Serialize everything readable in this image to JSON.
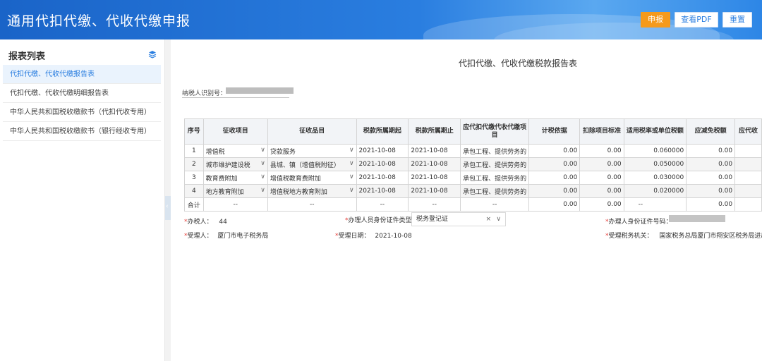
{
  "header": {
    "title": "通用代扣代缴、代收代缴申报",
    "buttons": {
      "submit": "申报",
      "pdf": "查看PDF",
      "reset": "重置"
    }
  },
  "sidebar": {
    "title": "报表列表",
    "items": [
      {
        "label": "代扣代缴、代收代缴报告表",
        "active": true
      },
      {
        "label": "代扣代缴、代收代缴明细报告表"
      },
      {
        "label": "中华人民共和国税收缴款书（代扣代收专用）"
      },
      {
        "label": "中华人民共和国税收缴款书（银行经收专用）"
      }
    ]
  },
  "main": {
    "report_title": "代扣代缴、代收代缴税款报告表",
    "taxpayer_id_label": "纳税人识别号："
  },
  "table": {
    "headers": [
      "序号",
      "征收项目",
      "征收品目",
      "税款所属期起",
      "税款所属期止",
      "应代扣代缴代收代缴项目",
      "计税依据",
      "扣除项目标准",
      "适用税率或单位税额",
      "应减免税额",
      "应代收"
    ],
    "rows": [
      {
        "no": "1",
        "item": "增值税",
        "subitem": "贷款服务",
        "start": "2021-10-08",
        "end": "2021-10-08",
        "project": "承包工程、提供劳务的",
        "basis": "0.00",
        "deduct": "0.00",
        "rate": "0.060000",
        "relief": "0.00"
      },
      {
        "no": "2",
        "item": "城市维护建设税",
        "subitem": "县城、镇（增值税附征）",
        "start": "2021-10-08",
        "end": "2021-10-08",
        "project": "承包工程、提供劳务的",
        "basis": "0.00",
        "deduct": "0.00",
        "rate": "0.050000",
        "relief": "0.00"
      },
      {
        "no": "3",
        "item": "教育费附加",
        "subitem": "增值税教育费附加",
        "start": "2021-10-08",
        "end": "2021-10-08",
        "project": "承包工程、提供劳务的",
        "basis": "0.00",
        "deduct": "0.00",
        "rate": "0.030000",
        "relief": "0.00"
      },
      {
        "no": "4",
        "item": "地方教育附加",
        "subitem": "增值税地方教育附加",
        "start": "2021-10-08",
        "end": "2021-10-08",
        "project": "承包工程、提供劳务的",
        "basis": "0.00",
        "deduct": "0.00",
        "rate": "0.020000",
        "relief": "0.00"
      }
    ],
    "total": {
      "label": "合计",
      "dash": "--",
      "basis": "0.00",
      "deduct": "0.00",
      "rate": "--",
      "relief": "0.00"
    }
  },
  "form": {
    "handler_label": "办税人：",
    "handler_value": "44",
    "cert_type_label": "办理人员身份证件类型：",
    "cert_type_value": "税务登记证",
    "cert_no_label": "办理人身份证件号码：",
    "receiver_label": "受理人：",
    "receiver_value": "厦门市电子税务局",
    "receive_date_label": "受理日期：",
    "receive_date_value": "2021-10-08",
    "receive_org_label": "受理税务机关：",
    "receive_org_value": "国家税务总局厦门市翔安区税务局进出口税",
    "required_mark": "*"
  },
  "colors": {
    "header": "#2a7ee0",
    "submit": "#f59a1c",
    "required": "#e53935"
  },
  "icons": {
    "layers": "layers-icon",
    "dropdown": "chevron-down-icon",
    "clear": "close-icon",
    "collapse": "chevron-left-icon"
  }
}
